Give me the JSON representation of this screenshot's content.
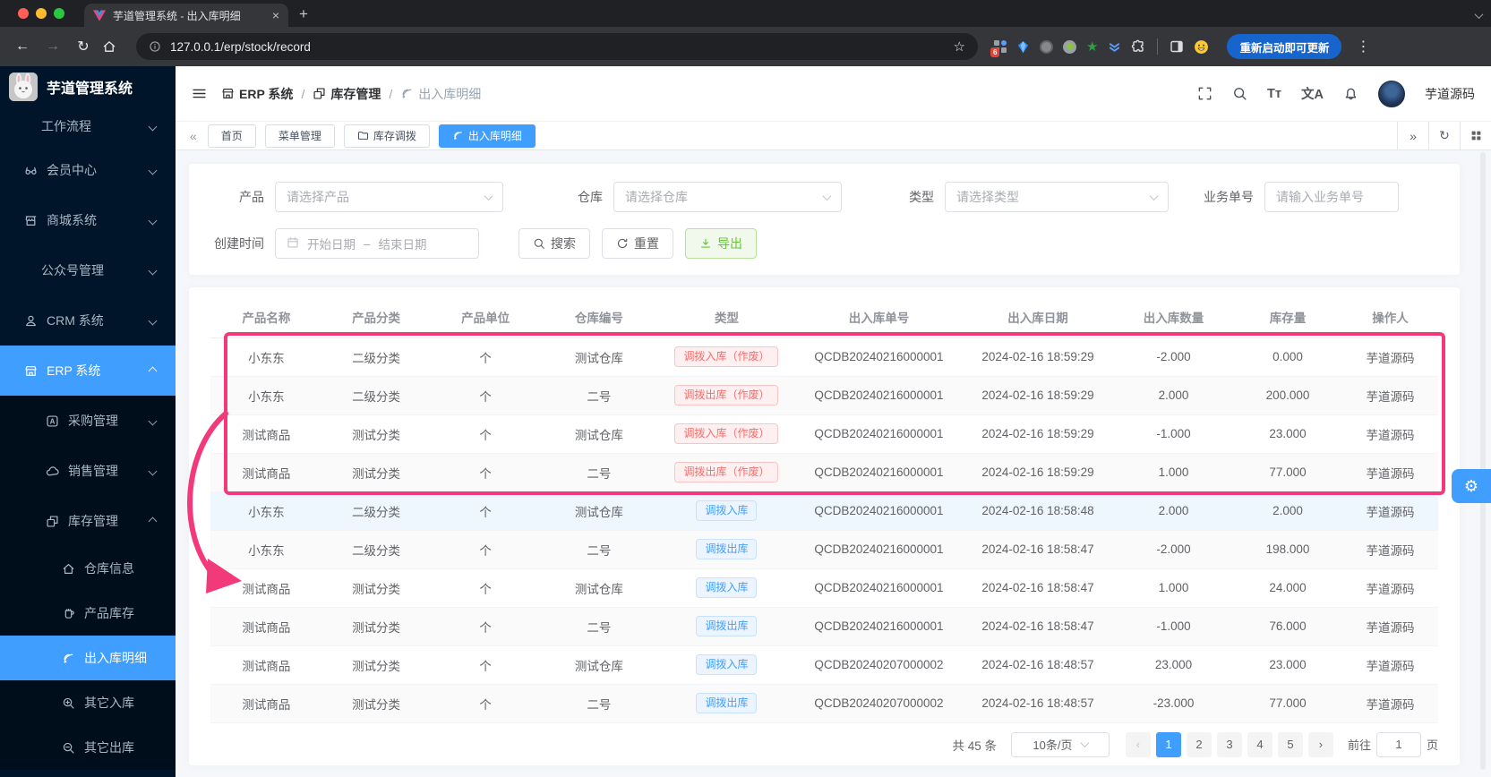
{
  "browser": {
    "tab_title": "芋道管理系统 - 出入库明细",
    "url": "127.0.0.1/erp/stock/record",
    "update_button": "重新启动即可更新",
    "extension_badge": "6",
    "extensions": [
      "grid-extension-icon",
      "gem-extension-icon",
      "gray-circle-extension-icon",
      "record-extension-icon",
      "star-extension-icon",
      "chevrons-extension-icon",
      "puzzle-extensions-icon",
      "sidepanel-icon",
      "emoji-profile-icon"
    ]
  },
  "sidebar": {
    "app_title": "芋道管理系统",
    "items": [
      {
        "label": "工作流程",
        "level": 2,
        "chevron": "down"
      },
      {
        "label": "会员中心",
        "icon": "glasses",
        "level": 1,
        "chevron": "down"
      },
      {
        "label": "商城系统",
        "icon": "shop",
        "level": 1,
        "chevron": "down"
      },
      {
        "label": "公众号管理",
        "level": 2,
        "chevron": "down"
      },
      {
        "label": "CRM 系统",
        "icon": "user",
        "level": 1,
        "chevron": "down"
      },
      {
        "label": "ERP 系统",
        "icon": "store",
        "level": 1,
        "chevron": "up",
        "active": true
      },
      {
        "label": "采购管理",
        "icon": "letter-a",
        "level": 2,
        "chevron": "down",
        "sub": true
      },
      {
        "label": "销售管理",
        "icon": "cloud",
        "level": 2,
        "chevron": "down",
        "sub": true
      },
      {
        "label": "库存管理",
        "icon": "boxes",
        "level": 2,
        "chevron": "up",
        "sub": true
      },
      {
        "label": "仓库信息",
        "icon": "home",
        "level": 3,
        "sub": true
      },
      {
        "label": "产品库存",
        "icon": "cup",
        "level": 3,
        "sub": true
      },
      {
        "label": "出入库明细",
        "icon": "signal",
        "level": 3,
        "active": true,
        "sub": true
      },
      {
        "label": "其它入库",
        "icon": "zoom-in",
        "level": 3,
        "sub": true
      },
      {
        "label": "其它出库",
        "icon": "zoom-out",
        "level": 3,
        "sub": true
      }
    ]
  },
  "header": {
    "breadcrumb": [
      {
        "label": "ERP 系统",
        "icon": "store"
      },
      {
        "label": "库存管理",
        "icon": "boxes"
      },
      {
        "label": "出入库明细",
        "icon": "signal",
        "muted": true
      }
    ],
    "separator": "/",
    "actions": [
      "fullscreen",
      "search",
      "font-size",
      "locale",
      "bell"
    ],
    "username": "芋道源码"
  },
  "tabnav": {
    "collapse_icon": "«",
    "tabs": [
      {
        "label": "首页"
      },
      {
        "label": "菜单管理"
      },
      {
        "label": "库存调拨",
        "icon": "folder"
      },
      {
        "label": "出入库明细",
        "icon": "signal",
        "active": true
      }
    ],
    "right_icons": [
      "chevrons-right",
      "refresh",
      "grid"
    ]
  },
  "filters": {
    "product": {
      "label": "产品",
      "placeholder": "请选择产品"
    },
    "warehouse": {
      "label": "仓库",
      "placeholder": "请选择仓库"
    },
    "type": {
      "label": "类型",
      "placeholder": "请选择类型"
    },
    "biz_no": {
      "label": "业务单号",
      "placeholder": "请输入业务单号"
    },
    "create_time": {
      "label": "创建时间",
      "start_placeholder": "开始日期",
      "separator": "–",
      "end_placeholder": "结束日期"
    },
    "search_button": "搜索",
    "reset_button": "重置",
    "export_button": "导出"
  },
  "table": {
    "columns": [
      "产品名称",
      "产品分类",
      "产品单位",
      "仓库编号",
      "类型",
      "出入库单号",
      "出入库日期",
      "出入库数量",
      "库存量",
      "操作人"
    ],
    "rows": [
      {
        "product": "小东东",
        "category": "二级分类",
        "unit": "个",
        "warehouse": "测试仓库",
        "type_label": "调拨入库（作废）",
        "type_variant": "danger",
        "order_no": "QCDB20240216000001",
        "datetime": "2024-02-16 18:59:29",
        "quantity": "-2.000",
        "stock": "0.000",
        "operator": "芋道源码"
      },
      {
        "product": "小东东",
        "category": "二级分类",
        "unit": "个",
        "warehouse": "二号",
        "type_label": "调拨出库（作废）",
        "type_variant": "danger",
        "order_no": "QCDB20240216000001",
        "datetime": "2024-02-16 18:59:29",
        "quantity": "2.000",
        "stock": "200.000",
        "operator": "芋道源码"
      },
      {
        "product": "测试商品",
        "category": "测试分类",
        "unit": "个",
        "warehouse": "测试仓库",
        "type_label": "调拨入库（作废）",
        "type_variant": "danger",
        "order_no": "QCDB20240216000001",
        "datetime": "2024-02-16 18:59:29",
        "quantity": "-1.000",
        "stock": "23.000",
        "operator": "芋道源码"
      },
      {
        "product": "测试商品",
        "category": "测试分类",
        "unit": "个",
        "warehouse": "二号",
        "type_label": "调拨出库（作废）",
        "type_variant": "danger",
        "order_no": "QCDB20240216000001",
        "datetime": "2024-02-16 18:59:29",
        "quantity": "1.000",
        "stock": "77.000",
        "operator": "芋道源码"
      },
      {
        "product": "小东东",
        "category": "二级分类",
        "unit": "个",
        "warehouse": "测试仓库",
        "type_label": "调拨入库",
        "type_variant": "primary",
        "order_no": "QCDB20240216000001",
        "datetime": "2024-02-16 18:58:48",
        "quantity": "2.000",
        "stock": "2.000",
        "operator": "芋道源码",
        "highlight": true
      },
      {
        "product": "小东东",
        "category": "二级分类",
        "unit": "个",
        "warehouse": "二号",
        "type_label": "调拨出库",
        "type_variant": "primary",
        "order_no": "QCDB20240216000001",
        "datetime": "2024-02-16 18:58:47",
        "quantity": "-2.000",
        "stock": "198.000",
        "operator": "芋道源码"
      },
      {
        "product": "测试商品",
        "category": "测试分类",
        "unit": "个",
        "warehouse": "测试仓库",
        "type_label": "调拨入库",
        "type_variant": "primary",
        "order_no": "QCDB20240216000001",
        "datetime": "2024-02-16 18:58:47",
        "quantity": "1.000",
        "stock": "24.000",
        "operator": "芋道源码"
      },
      {
        "product": "测试商品",
        "category": "测试分类",
        "unit": "个",
        "warehouse": "二号",
        "type_label": "调拨出库",
        "type_variant": "primary",
        "order_no": "QCDB20240216000001",
        "datetime": "2024-02-16 18:58:47",
        "quantity": "-1.000",
        "stock": "76.000",
        "operator": "芋道源码"
      },
      {
        "product": "测试商品",
        "category": "测试分类",
        "unit": "个",
        "warehouse": "测试仓库",
        "type_label": "调拨入库",
        "type_variant": "primary",
        "order_no": "QCDB20240207000002",
        "datetime": "2024-02-16 18:48:57",
        "quantity": "23.000",
        "stock": "23.000",
        "operator": "芋道源码"
      },
      {
        "product": "测试商品",
        "category": "测试分类",
        "unit": "个",
        "warehouse": "二号",
        "type_label": "调拨出库",
        "type_variant": "primary",
        "order_no": "QCDB20240207000002",
        "datetime": "2024-02-16 18:48:57",
        "quantity": "-23.000",
        "stock": "77.000",
        "operator": "芋道源码"
      }
    ]
  },
  "pagination": {
    "total": "共 45 条",
    "page_size": "10条/页",
    "pages": [
      "1",
      "2",
      "3",
      "4",
      "5"
    ],
    "active_page": "1",
    "goto_label": "前往",
    "goto_value": "1",
    "page_unit": "页"
  },
  "annotation": {
    "color": "#f23a7b"
  }
}
